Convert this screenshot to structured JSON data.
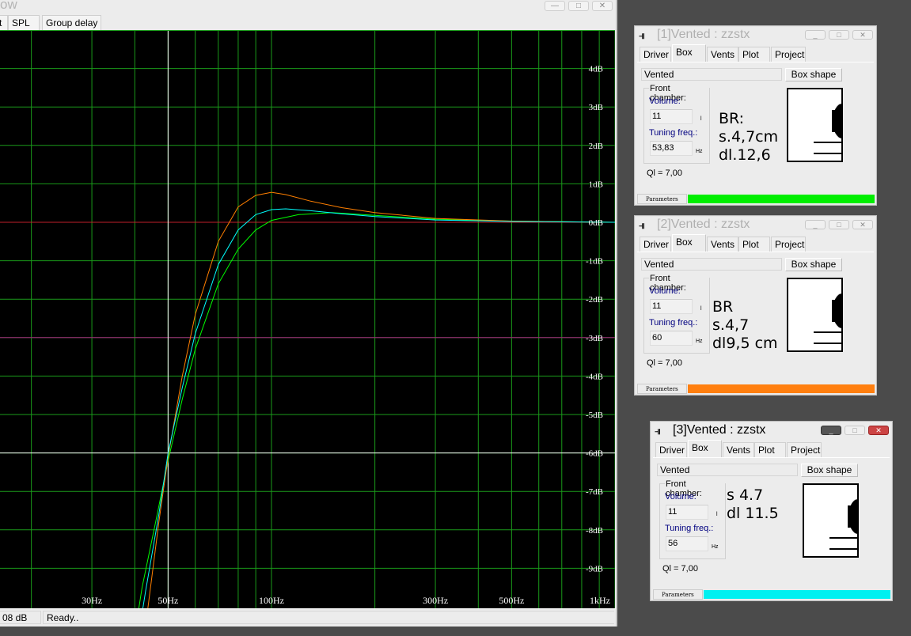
{
  "main": {
    "title_fragment": "ow",
    "tabs": [
      "t",
      "SPL",
      "Group delay"
    ],
    "status": {
      "value": "08 dB",
      "message": "Ready.."
    },
    "buttons": {
      "minimize": "—",
      "maximize": "□",
      "close": "✕"
    }
  },
  "chart_data": {
    "type": "line",
    "xscale": "log",
    "xlim": [
      16,
      1000
    ],
    "ylim": [
      -10,
      5
    ],
    "x_tick_labels": [
      {
        "f": 30,
        "label": "30Hz"
      },
      {
        "f": 50,
        "label": "50Hz"
      },
      {
        "f": 100,
        "label": "100Hz"
      },
      {
        "f": 300,
        "label": "300Hz"
      },
      {
        "f": 500,
        "label": "500Hz"
      },
      {
        "f": 1000,
        "label": "1kHz"
      }
    ],
    "y_tick_labels": [
      {
        "v": 4,
        "label": "4dB"
      },
      {
        "v": 3,
        "label": "3dB"
      },
      {
        "v": 2,
        "label": "2dB"
      },
      {
        "v": 1,
        "label": "1dB"
      },
      {
        "v": 0,
        "label": "0dB"
      },
      {
        "v": -1,
        "label": "-1dB"
      },
      {
        "v": -2,
        "label": "-2dB"
      },
      {
        "v": -3,
        "label": "-3dB"
      },
      {
        "v": -4,
        "label": "-4dB"
      },
      {
        "v": -5,
        "label": "-5dB"
      },
      {
        "v": -6,
        "label": "-6dB"
      },
      {
        "v": -7,
        "label": "-7dB"
      },
      {
        "v": -8,
        "label": "-8dB"
      },
      {
        "v": -9,
        "label": "-9dB"
      }
    ],
    "cursor": {
      "f": 50,
      "db": -6
    },
    "reference_lines": [
      {
        "db": 0,
        "color": "#c0202a"
      },
      {
        "db": -3,
        "color": "#a01e7a"
      }
    ],
    "series": [
      {
        "name": "[1]Vented",
        "color": "#00ff00",
        "x": [
          38,
          42,
          46,
          50,
          55,
          60,
          70,
          80,
          90,
          100,
          120,
          150,
          200,
          300,
          500,
          1000
        ],
        "y": [
          -12,
          -9.5,
          -7.8,
          -6.2,
          -4.6,
          -3.3,
          -1.6,
          -0.7,
          -0.2,
          0.05,
          0.2,
          0.25,
          0.18,
          0.08,
          0.03,
          0
        ]
      },
      {
        "name": "[2]Vented",
        "color": "#ff7f00",
        "x": [
          41,
          44,
          47,
          50,
          55,
          60,
          70,
          80,
          90,
          100,
          110,
          130,
          160,
          200,
          300,
          500,
          1000
        ],
        "y": [
          -12,
          -9.8,
          -7.8,
          -6.1,
          -4.0,
          -2.4,
          -0.5,
          0.4,
          0.7,
          0.78,
          0.72,
          0.55,
          0.38,
          0.25,
          0.1,
          0.03,
          0
        ]
      },
      {
        "name": "[3]Vented",
        "color": "#00ffff",
        "x": [
          39,
          43,
          47,
          50,
          55,
          60,
          70,
          80,
          90,
          100,
          110,
          130,
          160,
          200,
          300,
          500,
          1000
        ],
        "y": [
          -12,
          -9.6,
          -7.6,
          -6.0,
          -4.3,
          -2.9,
          -1.1,
          -0.2,
          0.2,
          0.33,
          0.35,
          0.3,
          0.22,
          0.15,
          0.06,
          0.02,
          0
        ]
      }
    ]
  },
  "windows": [
    {
      "title": "[1]Vented : zzstx",
      "tabs": [
        "Driver",
        "Box",
        "Vents",
        "Plot",
        "Project"
      ],
      "box_type": "Vented",
      "box_shape_label": "Box shape",
      "front_chamber": "Front chamber:",
      "volume_label": "Volume:",
      "volume": "11",
      "volume_unit": "l",
      "tuning_label": "Tuning freq.:",
      "tuning": "53,83",
      "tuning_unit": "Hz",
      "note": "BR:\ns.4,7cm\ndl.12,6",
      "ql": "Ql = 7,00",
      "status": "Parameters",
      "color": "#00ee00"
    },
    {
      "title": "[2]Vented : zzstx",
      "tabs": [
        "Driver",
        "Box",
        "Vents",
        "Plot",
        "Project"
      ],
      "box_type": "Vented",
      "box_shape_label": "Box shape",
      "front_chamber": "Front chamber:",
      "volume_label": "Volume:",
      "volume": "11",
      "volume_unit": "l",
      "tuning_label": "Tuning freq.:",
      "tuning": "60",
      "tuning_unit": "Hz",
      "note": "BR\ns.4,7\ndl9,5 cm",
      "ql": "Ql = 7,00",
      "status": "Parameters",
      "color": "#ff7f0f"
    },
    {
      "title": "[3]Vented : zzstx",
      "tabs": [
        "Driver",
        "Box",
        "Vents",
        "Plot",
        "Project"
      ],
      "box_type": "Vented",
      "box_shape_label": "Box shape",
      "front_chamber": "Front chamber:",
      "volume_label": "Volume:",
      "volume": "11",
      "volume_unit": "l",
      "tuning_label": "Tuning freq.:",
      "tuning": "56",
      "tuning_unit": "Hz",
      "note": "s 4.7\ndl 11.5",
      "ql": "Ql = 7,00",
      "status": "Parameters",
      "color": "#00f0f0"
    }
  ]
}
